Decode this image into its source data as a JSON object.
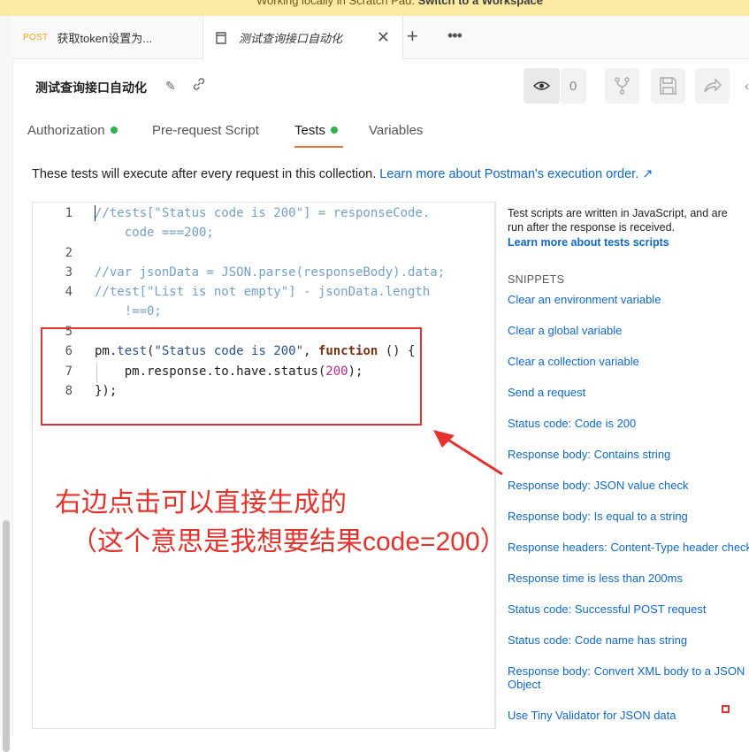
{
  "banner": {
    "text": "Working locally in Scratch Pad.",
    "action": "Switch to a Workspace"
  },
  "tabs": [
    {
      "method": "POST",
      "title": "获取token设置为..."
    },
    {
      "title": "测试查询接口自动化"
    }
  ],
  "header": {
    "title": "测试查询接口自动化",
    "watch_count": "0"
  },
  "subtabs": {
    "authorization": "Authorization",
    "prerequest": "Pre-request Script",
    "tests": "Tests",
    "variables": "Variables"
  },
  "description": {
    "text": "These tests will execute after every request in this collection. ",
    "link": "Learn more about Postman's execution order. ↗"
  },
  "code": {
    "line_numbers": [
      "1",
      "2",
      "3",
      "4",
      "5",
      "6",
      "7",
      "8"
    ],
    "l1a": "//tests[\"Status code is 200\"] = responseCode.",
    "l1b": "    code ===200;",
    "l3": "//var jsonData = JSON.parse(responseBody).data;",
    "l4a": "//test[\"List is not empty\"] - jsonData.length",
    "l4b": "    !==0;",
    "l6_obj": "pm.",
    "l6_fn": "test",
    "l6_open": "(",
    "l6_str": "\"Status code is 200\"",
    "l6_comma": ", ",
    "l6_kw": "function",
    "l6_tail": " () {",
    "l7_lead": "    pm.response.to.have.status(",
    "l7_num": "200",
    "l7_tail": ");",
    "l8": "});"
  },
  "annotation": {
    "line1": "右边点击可以直接生成的",
    "line2": "（这个意思是我想要结果code=200）"
  },
  "sidebar": {
    "help": "Test scripts are written in JavaScript, and are run after the response is received.",
    "learn": "Learn more about tests scripts",
    "snippets_heading": "SNIPPETS",
    "snippets": [
      "Clear an environment variable",
      "Clear a global variable",
      "Clear a collection variable",
      "Send a request",
      "Status code: Code is 200",
      "Response body: Contains string",
      "Response body: JSON value check",
      "Response body: Is equal to a string",
      "Response headers: Content-Type header check",
      "Response time is less than 200ms",
      "Status code: Successful POST request",
      "Status code: Code name has string",
      "Response body: Convert XML body to a JSON",
      "Object",
      "Use Tiny Validator for JSON data"
    ]
  },
  "colors": {
    "accent": "#ff6c37",
    "link": "#0f68c9",
    "success": "#2cb34a",
    "annotation": "#e5322d"
  },
  "icons": [
    "pencil-icon",
    "link-icon",
    "eye-icon",
    "fork-icon",
    "save-icon",
    "share-icon",
    "plus-icon",
    "more-icon",
    "close-icon",
    "collection-icon",
    "arrow-icon"
  ]
}
